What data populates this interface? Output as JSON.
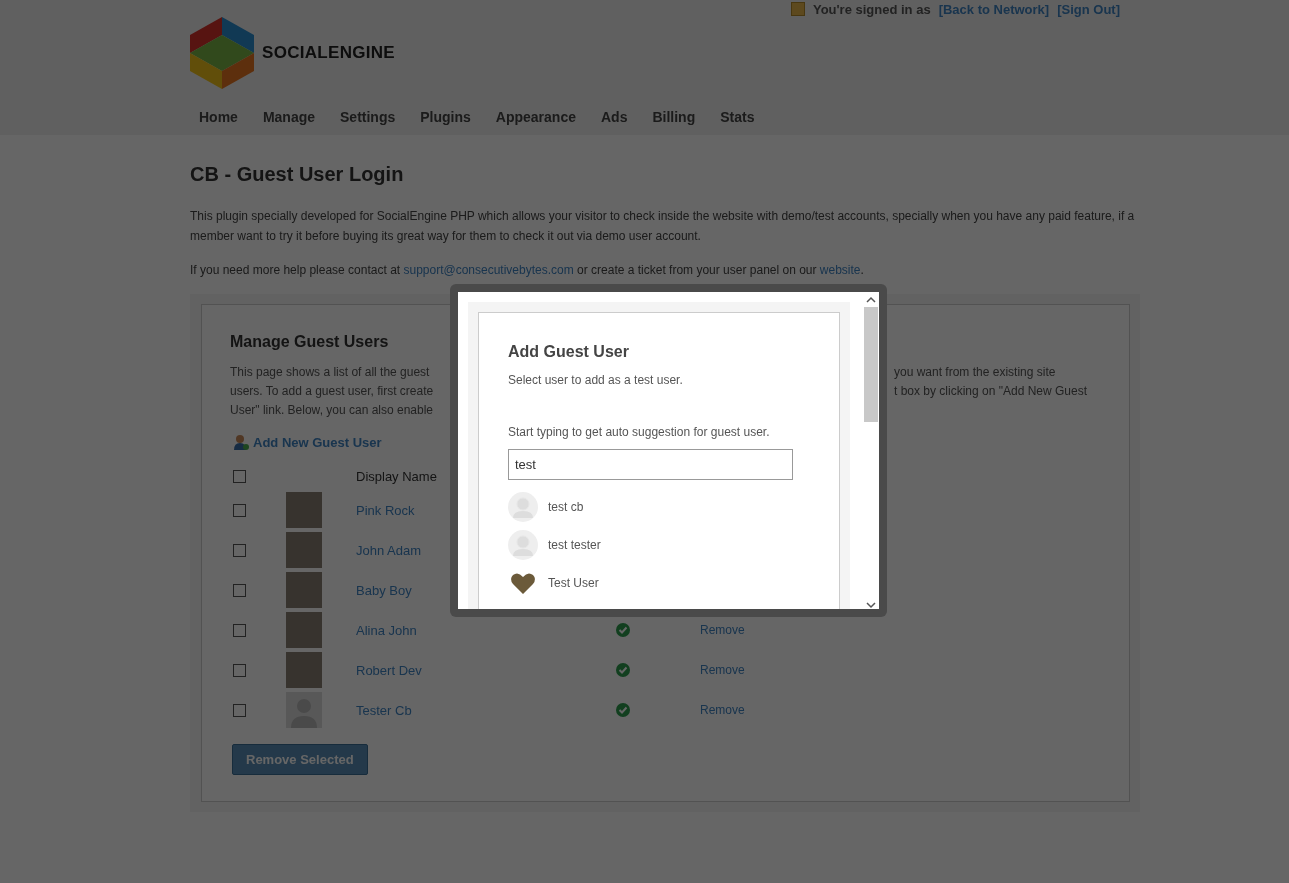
{
  "header": {
    "signed_in": "You're signed in as",
    "links": [
      "[Back to Network]",
      "[Sign Out]"
    ],
    "logo_text": "SOCIALENGINE",
    "nav": [
      "Home",
      "Manage",
      "Settings",
      "Plugins",
      "Appearance",
      "Ads",
      "Billing",
      "Stats"
    ]
  },
  "page": {
    "title": "CB - Guest User Login",
    "intro": "This plugin specially developed for SocialEngine PHP which allows your visitor to check inside the website with demo/test accounts, specially when you have any paid feature, if a member want to try it before buying its great way for them to check it out via demo user account.",
    "help_before": "If you need more help please contact at",
    "help_email": "support@consecutivebytes.com",
    "help_middle": "or create a ticket from your user panel on our",
    "help_link": "website",
    "help_after": "."
  },
  "manage": {
    "title": "Manage Guest Users",
    "desc_left": [
      "This page shows a list of all the guest",
      "users. To add a guest user, first create",
      "User\" link. Below, you can also enable"
    ],
    "desc_right": [
      "you want from the existing site",
      "t box by clicking on \"Add New Guest"
    ],
    "add_link": "Add New Guest User",
    "column_name": "Display Name",
    "header_checked": false,
    "rows": [
      {
        "name": "Pink Rock",
        "checked": false,
        "kind": "photo"
      },
      {
        "name": "John Adam",
        "checked": false,
        "kind": "photo"
      },
      {
        "name": "Baby Boy",
        "checked": false,
        "kind": "photo"
      },
      {
        "name": "Alina John",
        "checked": false,
        "kind": "photo",
        "enabled": true,
        "action": "Remove"
      },
      {
        "name": "Robert Dev",
        "checked": false,
        "kind": "photo",
        "enabled": true,
        "action": "Remove"
      },
      {
        "name": "Tester Cb",
        "checked": false,
        "kind": "default",
        "enabled": true,
        "action": "Remove"
      }
    ],
    "remove_button": "Remove Selected"
  },
  "dialog": {
    "title": "Add Guest User",
    "subtitle": "Select user to add as a test user.",
    "hint": "Start typing to get auto suggestion for guest user.",
    "search_value": "test",
    "suggestions": [
      {
        "name": "test cb",
        "kind": "default"
      },
      {
        "name": "test tester",
        "kind": "default"
      },
      {
        "name": "Test User",
        "kind": "heart"
      }
    ]
  }
}
